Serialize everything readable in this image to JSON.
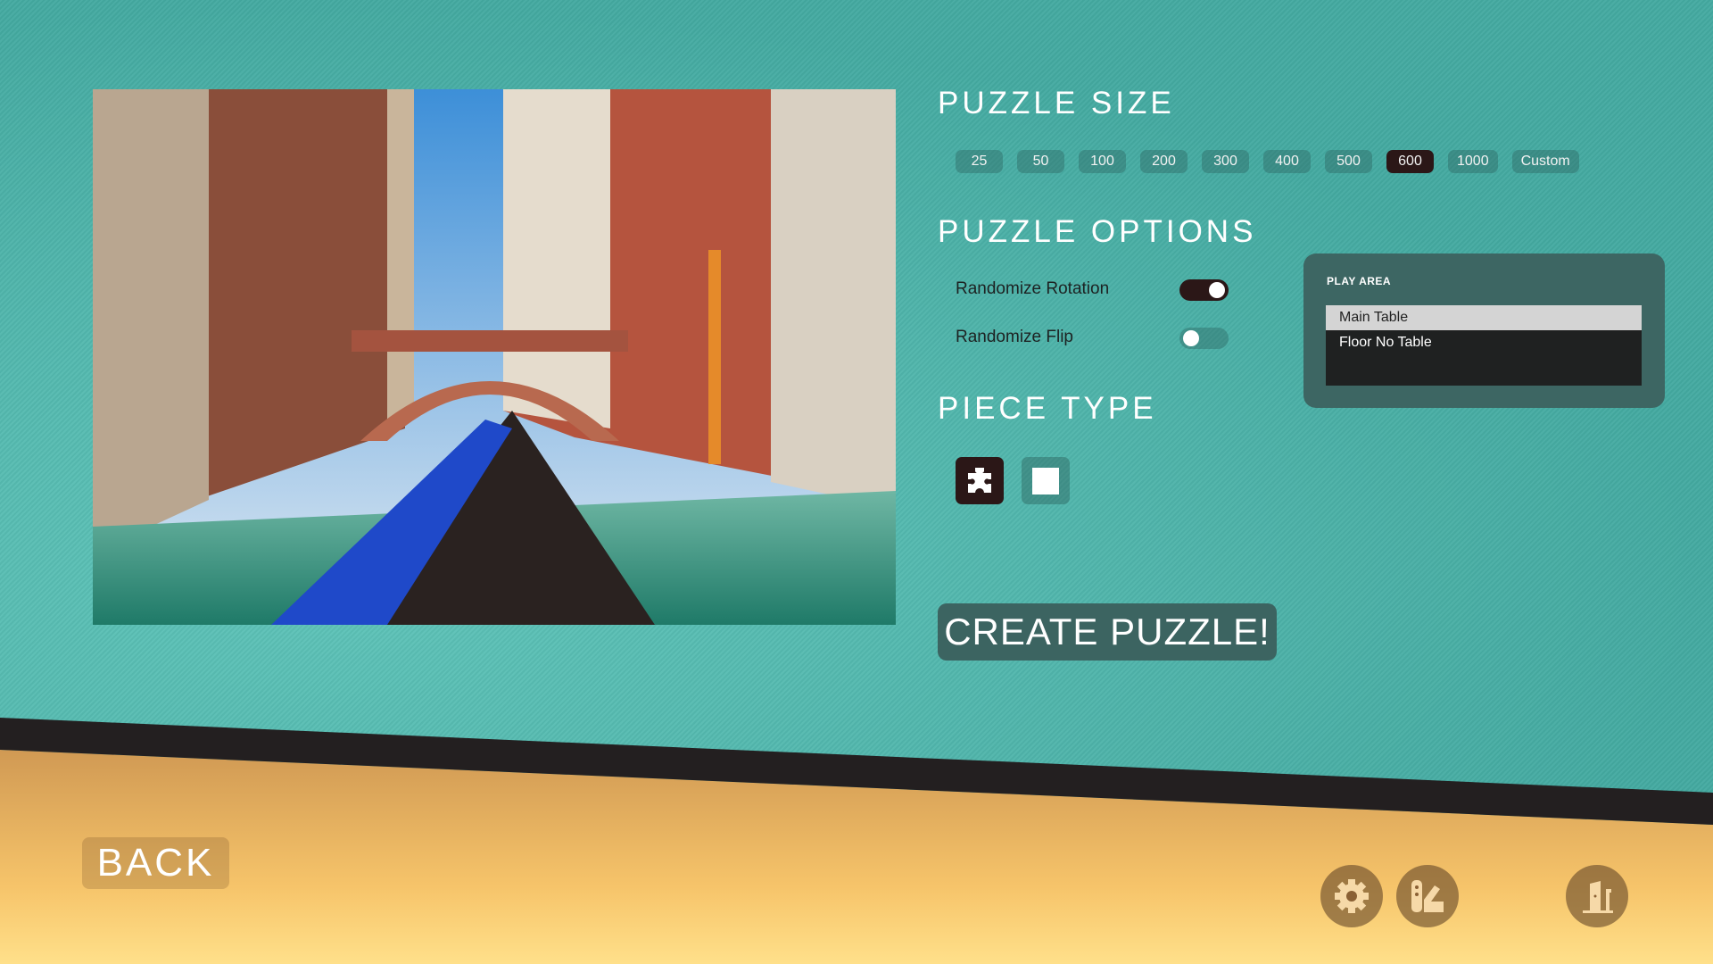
{
  "puzzle_size": {
    "heading": "PUZZLE SIZE",
    "options": [
      "25",
      "50",
      "100",
      "200",
      "300",
      "400",
      "500",
      "600",
      "1000",
      "Custom"
    ],
    "selected": "600"
  },
  "puzzle_options": {
    "heading": "PUZZLE OPTIONS",
    "randomize_rotation": {
      "label": "Randomize Rotation",
      "on": true
    },
    "randomize_flip": {
      "label": "Randomize Flip",
      "on": false
    }
  },
  "play_area": {
    "title": "PLAY AREA",
    "items": [
      "Main Table",
      "Floor No Table"
    ],
    "selected": "Main Table"
  },
  "piece_type": {
    "heading": "PIECE TYPE",
    "options": [
      "jigsaw-piece-icon",
      "square-piece-icon"
    ],
    "selected": "jigsaw-piece-icon"
  },
  "create_label": "CREATE PUZZLE!",
  "back_label": "BACK",
  "footer_icons": [
    "gear-icon",
    "palette-icon",
    "exit-door-icon"
  ],
  "colors": {
    "background": "#4cb8ae",
    "selected": "#2b1717",
    "panel": "#3d6663",
    "bottom": "#c9914f"
  }
}
